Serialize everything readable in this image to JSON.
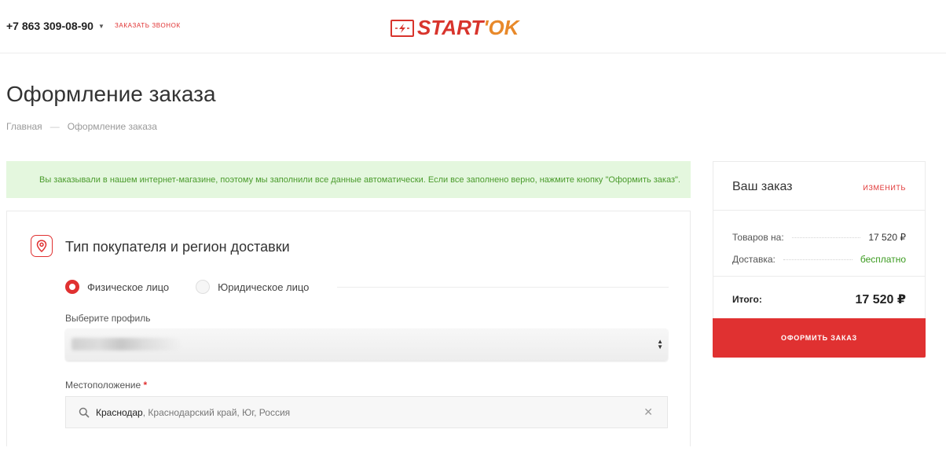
{
  "header": {
    "phone": "+7 863 309-08-90",
    "callback_label": "ЗАКАЗАТЬ ЗВОНОК",
    "logo": {
      "part1": "START",
      "part2": "'OK"
    }
  },
  "page": {
    "title": "Оформление заказа",
    "breadcrumb": {
      "home": "Главная",
      "separator": "—",
      "current": "Оформление заказа"
    }
  },
  "notice": "Вы заказывали в нашем интернет-магазине, поэтому мы заполнили все данные автоматически. Если все заполнено верно, нажмите кнопку \"Оформить заказ\".",
  "section": {
    "title": "Тип покупателя и регион доставки",
    "buyer_types": [
      {
        "label": "Физическое лицо",
        "selected": true
      },
      {
        "label": "Юридическое лицо",
        "selected": false
      }
    ],
    "profile_label": "Выберите профиль",
    "location_label": "Местоположение",
    "required_mark": "*",
    "location": {
      "city": "Краснодар",
      "rest": ", Краснодарский край, Юг, Россия"
    }
  },
  "summary": {
    "title": "Ваш заказ",
    "edit_label": "ИЗМЕНИТЬ",
    "goods_label": "Товаров на:",
    "goods_value": "17 520 ₽",
    "delivery_label": "Доставка:",
    "delivery_value": "бесплатно",
    "total_label": "Итого:",
    "total_value": "17 520 ₽",
    "order_button": "ОФОРМИТЬ ЗАКАЗ"
  },
  "colors": {
    "accent": "#e03131",
    "logo_orange": "#e8892a",
    "success": "#3c9b20",
    "notice_bg": "#e4f7de"
  }
}
